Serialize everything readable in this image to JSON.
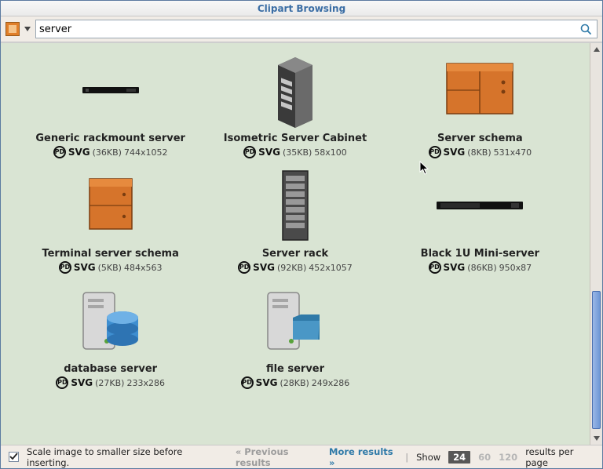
{
  "window": {
    "title": "Clipart Browsing"
  },
  "search": {
    "value": "server",
    "placeholder": ""
  },
  "constants": {
    "pd_label": "PD",
    "svg_tag": "SVG"
  },
  "items": [
    {
      "title": "Generic rackmount server",
      "filesize": "(36KB)",
      "dims": "744x1052"
    },
    {
      "title": "Isometric Server Cabinet",
      "filesize": "(35KB)",
      "dims": "58x100"
    },
    {
      "title": "Server schema",
      "filesize": "(8KB)",
      "dims": "531x470"
    },
    {
      "title": "Terminal server schema",
      "filesize": "(5KB)",
      "dims": "484x563"
    },
    {
      "title": "Server rack",
      "filesize": "(92KB)",
      "dims": "452x1057"
    },
    {
      "title": "Black 1U Mini-server",
      "filesize": "(86KB)",
      "dims": "950x87"
    },
    {
      "title": "database server",
      "filesize": "(27KB)",
      "dims": "233x286"
    },
    {
      "title": "file server",
      "filesize": "(28KB)",
      "dims": "249x286"
    }
  ],
  "footer": {
    "scale_label": "Scale image to smaller size before inserting.",
    "scale_checked": true,
    "prev": "« Previous results",
    "more": "More results »",
    "show_label": "Show",
    "per_page_options": [
      "24",
      "60",
      "120"
    ],
    "per_page_selected": "24",
    "per_page_suffix": "results per page"
  }
}
